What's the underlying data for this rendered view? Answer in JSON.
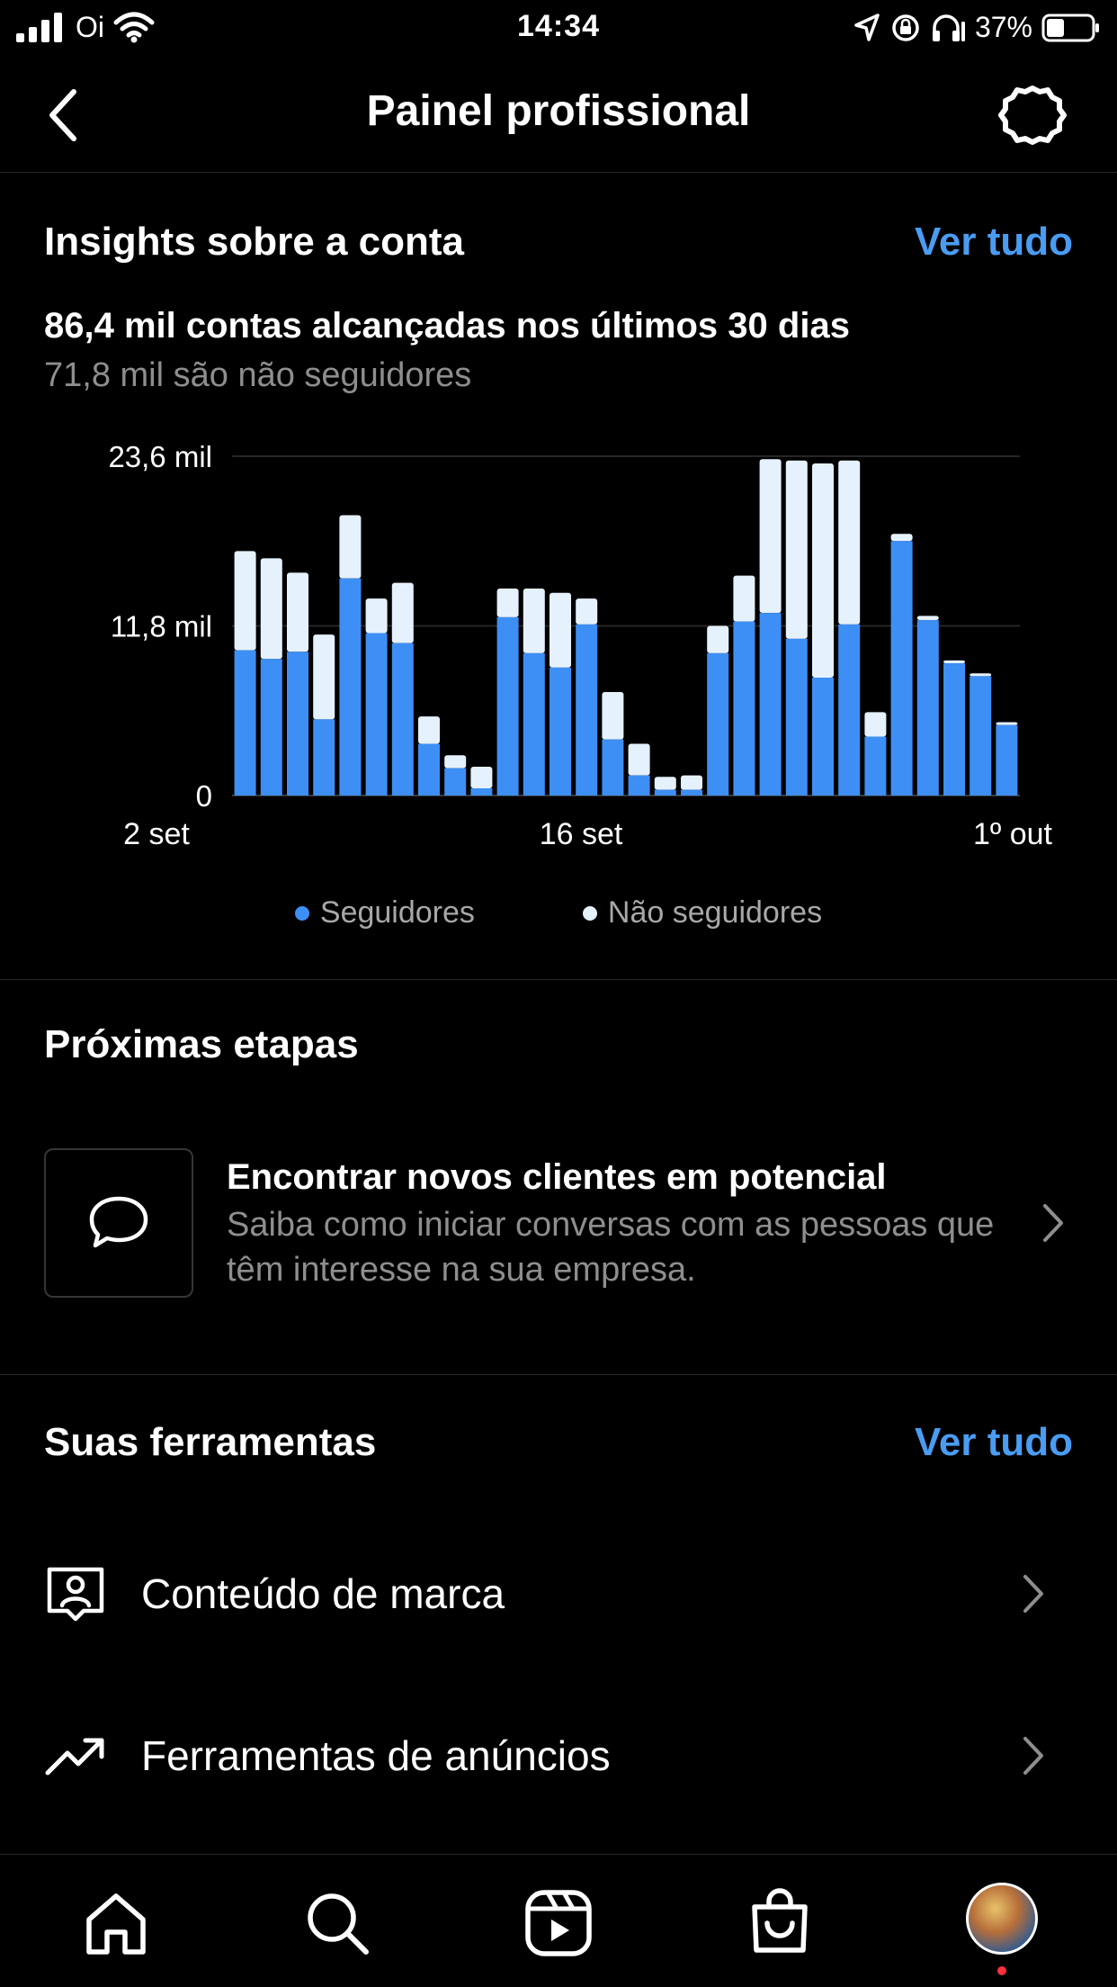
{
  "status_bar": {
    "carrier": "Oi",
    "time": "14:34",
    "battery": "37%"
  },
  "nav": {
    "title": "Painel profissional"
  },
  "insights": {
    "title": "Insights sobre a conta",
    "see_all": "Ver tudo",
    "reach_line": "86,4 mil contas alcançadas nos últimos 30 dias",
    "reach_sub": "71,8 mil são não seguidores"
  },
  "chart_data": {
    "type": "bar",
    "stacked": true,
    "title": "",
    "xlabel": "",
    "ylabel": "",
    "y_tick_labels": [
      "23,6 mil",
      "11,8 mil",
      "0"
    ],
    "y_ticks": [
      23.6,
      11.8,
      0
    ],
    "ylim": [
      0,
      23.6
    ],
    "x_tick_labels": [
      "2 set",
      "16 set",
      "1º out"
    ],
    "x_tick_index": [
      0,
      14,
      29
    ],
    "categories": [
      "2 set",
      "3 set",
      "4 set",
      "5 set",
      "6 set",
      "7 set",
      "8 set",
      "9 set",
      "10 set",
      "11 set",
      "12 set",
      "13 set",
      "14 set",
      "15 set",
      "16 set",
      "17 set",
      "18 set",
      "19 set",
      "20 set",
      "21 set",
      "22 set",
      "23 set",
      "24 set",
      "25 set",
      "26 set",
      "27 set",
      "28 set",
      "29 set",
      "30 set",
      "1º out"
    ],
    "series": [
      {
        "name": "Seguidores",
        "color": "#3d8ff5",
        "values": [
          10.1,
          9.5,
          10.0,
          5.3,
          15.1,
          11.3,
          10.6,
          3.6,
          1.9,
          0.5,
          12.4,
          9.9,
          8.9,
          11.9,
          3.9,
          1.4,
          0.4,
          0.4,
          9.9,
          12.1,
          12.7,
          10.9,
          8.2,
          11.9,
          4.1,
          17.7,
          12.2,
          9.2,
          8.3,
          4.9
        ]
      },
      {
        "name": "Não seguidores",
        "color": "#e5f1fc",
        "values": [
          6.9,
          7.0,
          5.5,
          5.9,
          4.4,
          2.4,
          4.2,
          1.9,
          0.9,
          1.5,
          2.0,
          4.5,
          5.2,
          1.8,
          3.3,
          2.2,
          0.9,
          1.0,
          1.9,
          3.2,
          10.7,
          12.4,
          14.9,
          11.4,
          1.7,
          0.5,
          0.3,
          0.2,
          0.2,
          0.2
        ]
      }
    ],
    "grid": true,
    "legend_position": "bottom"
  },
  "next_steps": {
    "title": "Próximas etapas",
    "card_title": "Encontrar novos clientes em potencial",
    "card_desc": "Saiba como iniciar conversas com as pessoas que têm interesse na sua empresa."
  },
  "tools": {
    "title": "Suas ferramentas",
    "see_all": "Ver tudo",
    "items": [
      {
        "label": "Conteúdo de marca",
        "icon": "branded-content-icon"
      },
      {
        "label": "Ferramentas de anúncios",
        "icon": "trending-up-icon"
      }
    ]
  },
  "tabbar": {
    "items": [
      "home-icon",
      "search-icon",
      "reels-icon",
      "shop-icon",
      "profile-avatar"
    ]
  },
  "colors": {
    "accent": "#4a9cf2",
    "followers": "#3d8ff5",
    "non_followers": "#e5f1fc",
    "background": "#000000"
  }
}
